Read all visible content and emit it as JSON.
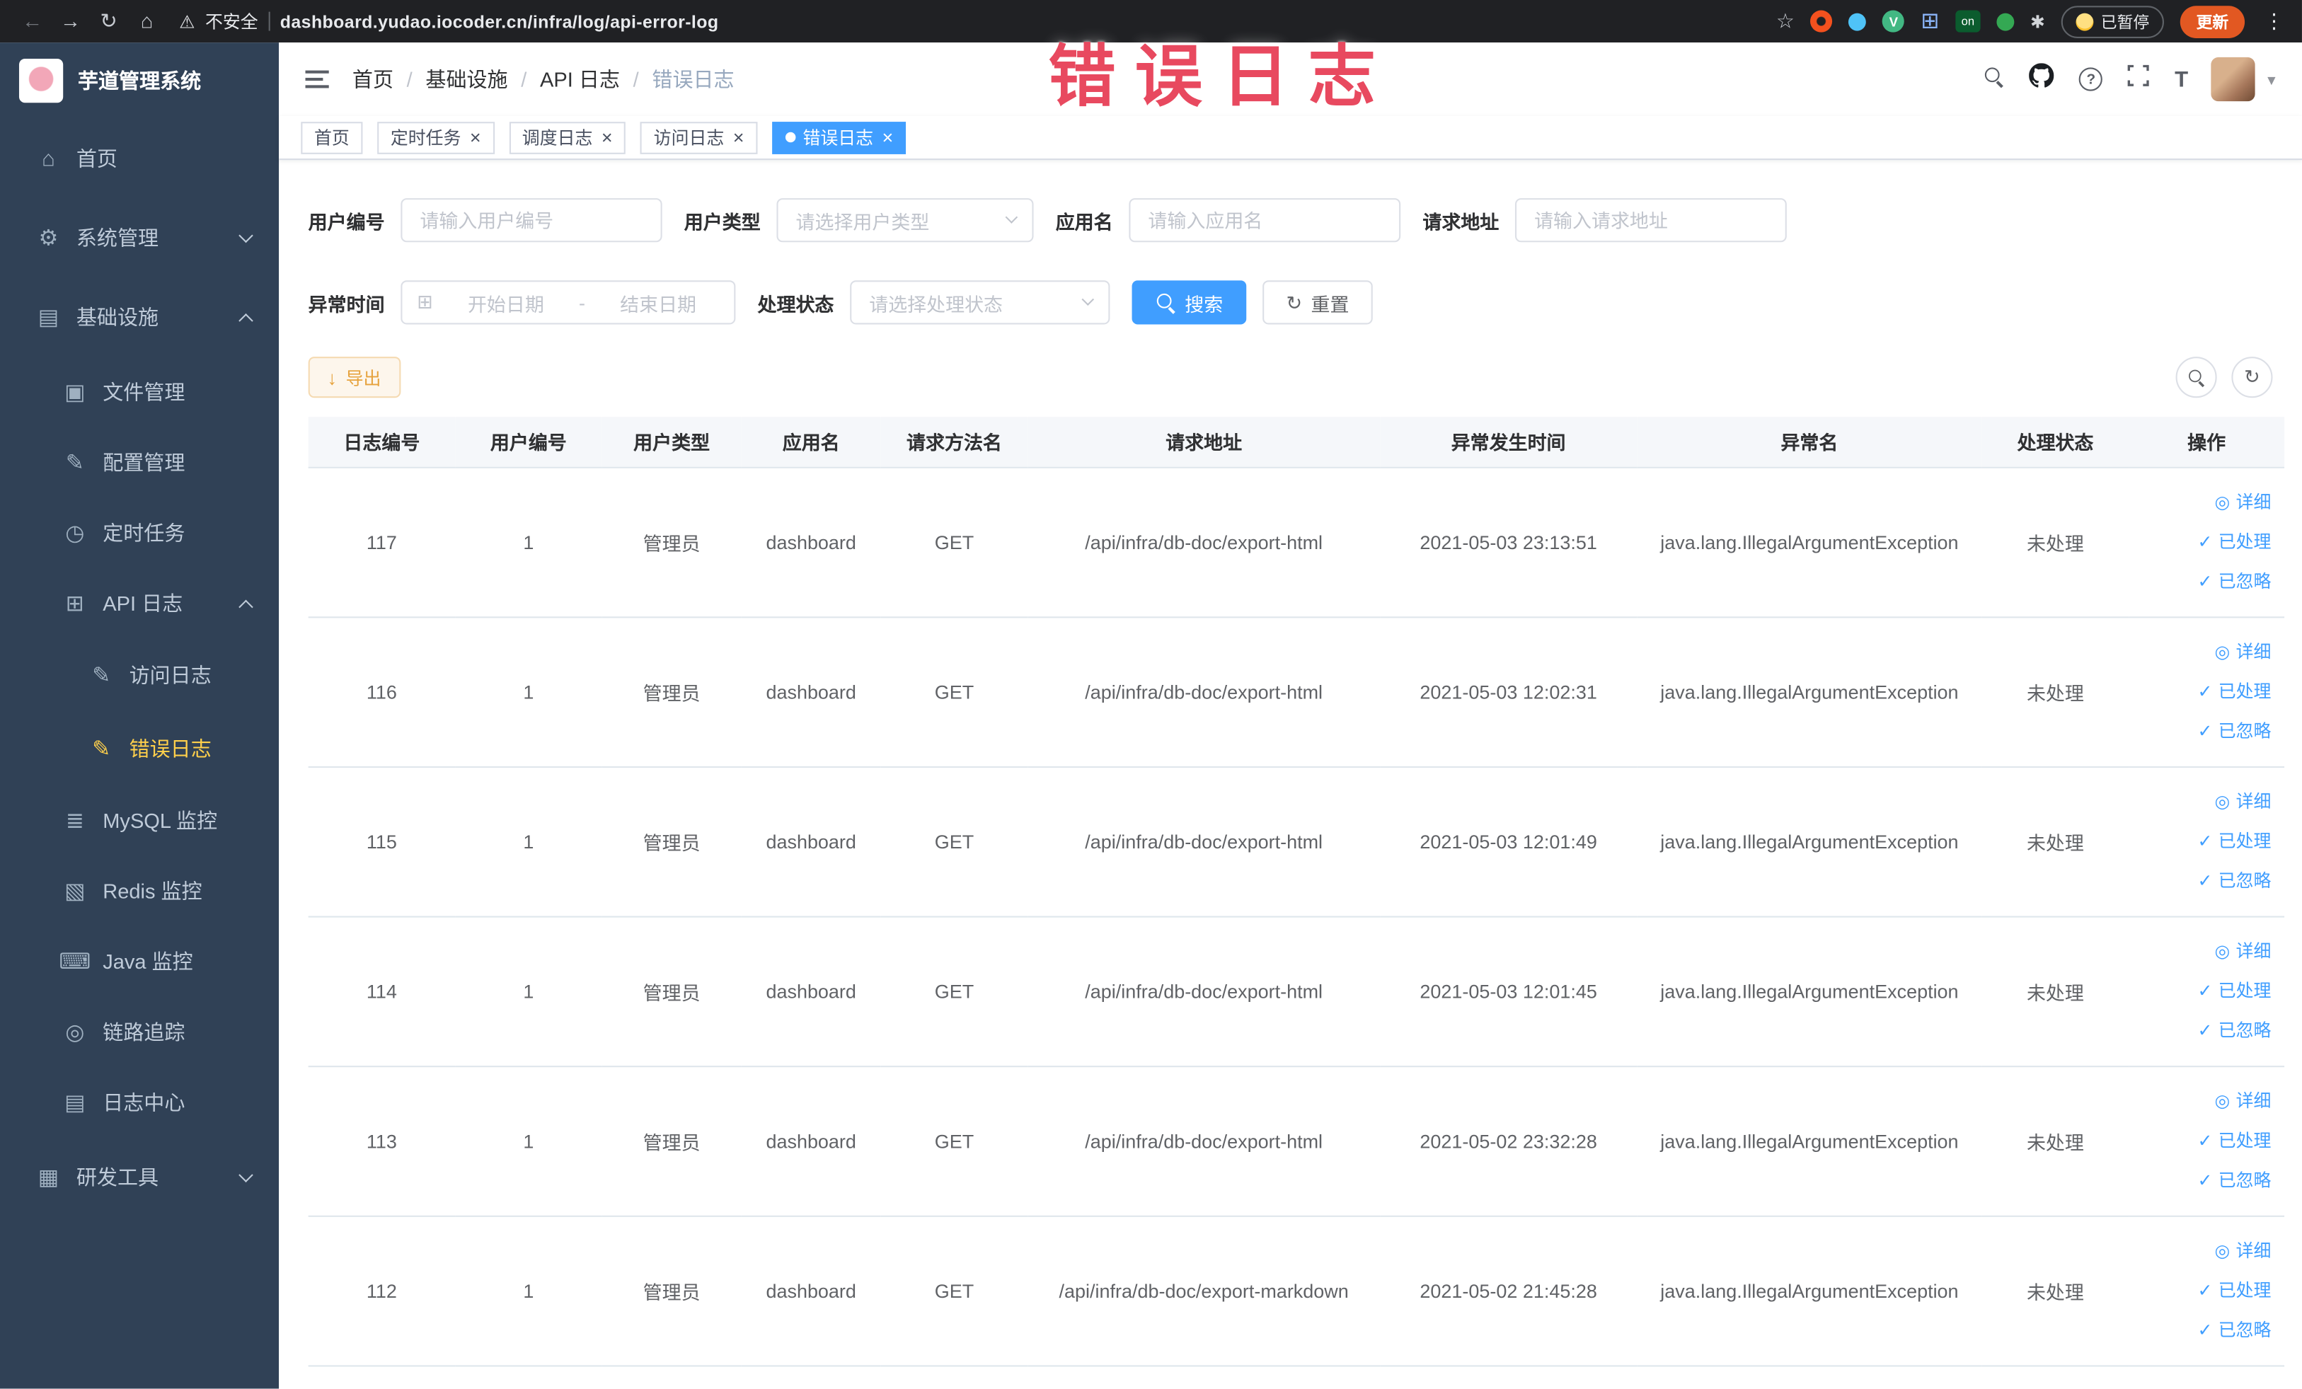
{
  "browser": {
    "security_label": "不安全",
    "url": "dashboard.yudao.iocoder.cn/infra/log/api-error-log",
    "on_badge": "on",
    "paused_badge": "已暂停",
    "update_button": "更新"
  },
  "annotation": {
    "text": "错误日志",
    "color": "#e8495f"
  },
  "sidebar": {
    "app_title": "芋道管理系统",
    "items": [
      {
        "key": "home",
        "label": "首页",
        "icon": "⌂",
        "level": 1
      },
      {
        "key": "system-management",
        "label": "系统管理",
        "icon": "⚙",
        "level": 1,
        "chevron": "down"
      },
      {
        "key": "infrastructure",
        "label": "基础设施",
        "icon": "▤",
        "level": 1,
        "chevron": "up"
      },
      {
        "key": "file-management",
        "label": "文件管理",
        "icon": "▣",
        "level": 2
      },
      {
        "key": "config-management",
        "label": "配置管理",
        "icon": "✎",
        "level": 2
      },
      {
        "key": "scheduled-tasks",
        "label": "定时任务",
        "icon": "◷",
        "level": 2
      },
      {
        "key": "api-log",
        "label": "API 日志",
        "icon": "⊞",
        "level": 2,
        "chevron": "up"
      },
      {
        "key": "access-log",
        "label": "访问日志",
        "icon": "✎",
        "level": 3
      },
      {
        "key": "error-log",
        "label": "错误日志",
        "icon": "✎",
        "level": 3,
        "active": true
      },
      {
        "key": "mysql-monitor",
        "label": "MySQL 监控",
        "icon": "≣",
        "level": 2
      },
      {
        "key": "redis-monitor",
        "label": "Redis 监控",
        "icon": "▧",
        "level": 2
      },
      {
        "key": "java-monitor",
        "label": "Java 监控",
        "icon": "⌨",
        "level": 2
      },
      {
        "key": "link-trace",
        "label": "链路追踪",
        "icon": "◎",
        "level": 2
      },
      {
        "key": "log-center",
        "label": "日志中心",
        "icon": "▤",
        "level": 2
      },
      {
        "key": "dev-tools",
        "label": "研发工具",
        "icon": "▦",
        "level": 1,
        "chevron": "down"
      }
    ]
  },
  "header": {
    "breadcrumb": [
      "首页",
      "基础设施",
      "API 日志",
      "错误日志"
    ]
  },
  "tabs": [
    {
      "key": "home",
      "label": "首页",
      "closable": false,
      "active": false
    },
    {
      "key": "scheduled-tasks",
      "label": "定时任务",
      "closable": true,
      "active": false
    },
    {
      "key": "schedule-log",
      "label": "调度日志",
      "closable": true,
      "active": false
    },
    {
      "key": "access-log",
      "label": "访问日志",
      "closable": true,
      "active": false
    },
    {
      "key": "error-log",
      "label": "错误日志",
      "closable": true,
      "active": true
    }
  ],
  "filters": {
    "user_id": {
      "label": "用户编号",
      "placeholder": "请输入用户编号"
    },
    "user_type": {
      "label": "用户类型",
      "placeholder": "请选择用户类型"
    },
    "app_name": {
      "label": "应用名",
      "placeholder": "请输入应用名"
    },
    "request_url": {
      "label": "请求地址",
      "placeholder": "请输入请求地址"
    },
    "exception_time": {
      "label": "异常时间",
      "start_placeholder": "开始日期",
      "separator": "-",
      "end_placeholder": "结束日期"
    },
    "process_status": {
      "label": "处理状态",
      "placeholder": "请选择处理状态"
    },
    "search_button": "搜索",
    "reset_button": "重置"
  },
  "toolbar": {
    "export_button": "导出"
  },
  "table": {
    "columns": [
      "日志编号",
      "用户编号",
      "用户类型",
      "应用名",
      "请求方法名",
      "请求地址",
      "异常发生时间",
      "异常名",
      "处理状态",
      "操作"
    ],
    "row_actions": [
      {
        "key": "detail",
        "label": "详细",
        "icon": "eye-icon"
      },
      {
        "key": "processed",
        "label": "已处理",
        "icon": "check-icon"
      },
      {
        "key": "ignored",
        "label": "已忽略",
        "icon": "check-icon"
      }
    ],
    "rows": [
      {
        "log_id": "117",
        "user_id": "1",
        "user_type": "管理员",
        "app_name": "dashboard",
        "method": "GET",
        "url": "/api/infra/db-doc/export-html",
        "time": "2021-05-03 23:13:51",
        "exception": "java.lang.IllegalArgumentException",
        "status": "未处理"
      },
      {
        "log_id": "116",
        "user_id": "1",
        "user_type": "管理员",
        "app_name": "dashboard",
        "method": "GET",
        "url": "/api/infra/db-doc/export-html",
        "time": "2021-05-03 12:02:31",
        "exception": "java.lang.IllegalArgumentException",
        "status": "未处理"
      },
      {
        "log_id": "115",
        "user_id": "1",
        "user_type": "管理员",
        "app_name": "dashboard",
        "method": "GET",
        "url": "/api/infra/db-doc/export-html",
        "time": "2021-05-03 12:01:49",
        "exception": "java.lang.IllegalArgumentException",
        "status": "未处理"
      },
      {
        "log_id": "114",
        "user_id": "1",
        "user_type": "管理员",
        "app_name": "dashboard",
        "method": "GET",
        "url": "/api/infra/db-doc/export-html",
        "time": "2021-05-03 12:01:45",
        "exception": "java.lang.IllegalArgumentException",
        "status": "未处理"
      },
      {
        "log_id": "113",
        "user_id": "1",
        "user_type": "管理员",
        "app_name": "dashboard",
        "method": "GET",
        "url": "/api/infra/db-doc/export-html",
        "time": "2021-05-02 23:32:28",
        "exception": "java.lang.IllegalArgumentException",
        "status": "未处理"
      },
      {
        "log_id": "112",
        "user_id": "1",
        "user_type": "管理员",
        "app_name": "dashboard",
        "method": "GET",
        "url": "/api/infra/db-doc/export-markdown",
        "time": "2021-05-02 21:45:28",
        "exception": "java.lang.IllegalArgumentException",
        "status": "未处理"
      }
    ]
  }
}
